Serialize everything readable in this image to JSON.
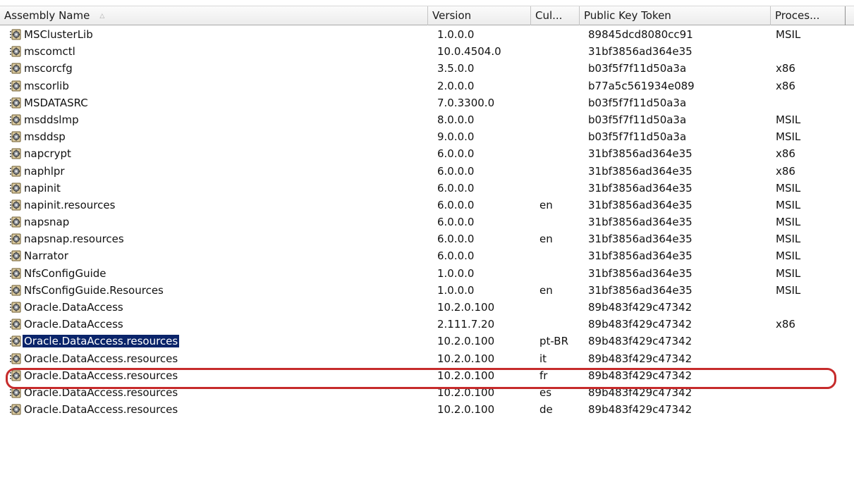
{
  "columns": [
    {
      "key": "name",
      "label": "Assembly Name"
    },
    {
      "key": "version",
      "label": "Version"
    },
    {
      "key": "culture",
      "label": "Cul..."
    },
    {
      "key": "token",
      "label": "Public Key Token"
    },
    {
      "key": "processor",
      "label": "Proces..."
    }
  ],
  "sort": {
    "column": "name",
    "direction": "ascending",
    "icon": "sort-ascending-icon"
  },
  "row_icon": "assembly-icon",
  "selected_row_index": 18,
  "highlight_color": "#c62b2b",
  "selection_color": "#0a246a",
  "rows": [
    {
      "name": "MSClusterLib",
      "version": "1.0.0.0",
      "culture": "",
      "token": "89845dcd8080cc91",
      "processor": "MSIL"
    },
    {
      "name": "mscomctl",
      "version": "10.0.4504.0",
      "culture": "",
      "token": "31bf3856ad364e35",
      "processor": ""
    },
    {
      "name": "mscorcfg",
      "version": "3.5.0.0",
      "culture": "",
      "token": "b03f5f7f11d50a3a",
      "processor": "x86"
    },
    {
      "name": "mscorlib",
      "version": "2.0.0.0",
      "culture": "",
      "token": "b77a5c561934e089",
      "processor": "x86"
    },
    {
      "name": "MSDATASRC",
      "version": "7.0.3300.0",
      "culture": "",
      "token": "b03f5f7f11d50a3a",
      "processor": ""
    },
    {
      "name": "msddslmp",
      "version": "8.0.0.0",
      "culture": "",
      "token": "b03f5f7f11d50a3a",
      "processor": "MSIL"
    },
    {
      "name": "msddsp",
      "version": "9.0.0.0",
      "culture": "",
      "token": "b03f5f7f11d50a3a",
      "processor": "MSIL"
    },
    {
      "name": "napcrypt",
      "version": "6.0.0.0",
      "culture": "",
      "token": "31bf3856ad364e35",
      "processor": "x86"
    },
    {
      "name": "naphlpr",
      "version": "6.0.0.0",
      "culture": "",
      "token": "31bf3856ad364e35",
      "processor": "x86"
    },
    {
      "name": "napinit",
      "version": "6.0.0.0",
      "culture": "",
      "token": "31bf3856ad364e35",
      "processor": "MSIL"
    },
    {
      "name": "napinit.resources",
      "version": "6.0.0.0",
      "culture": "en",
      "token": "31bf3856ad364e35",
      "processor": "MSIL"
    },
    {
      "name": "napsnap",
      "version": "6.0.0.0",
      "culture": "",
      "token": "31bf3856ad364e35",
      "processor": "MSIL"
    },
    {
      "name": "napsnap.resources",
      "version": "6.0.0.0",
      "culture": "en",
      "token": "31bf3856ad364e35",
      "processor": "MSIL"
    },
    {
      "name": "Narrator",
      "version": "6.0.0.0",
      "culture": "",
      "token": "31bf3856ad364e35",
      "processor": "MSIL"
    },
    {
      "name": "NfsConfigGuide",
      "version": "1.0.0.0",
      "culture": "",
      "token": "31bf3856ad364e35",
      "processor": "MSIL"
    },
    {
      "name": "NfsConfigGuide.Resources",
      "version": "1.0.0.0",
      "culture": "en",
      "token": "31bf3856ad364e35",
      "processor": "MSIL"
    },
    {
      "name": "Oracle.DataAccess",
      "version": "10.2.0.100",
      "culture": "",
      "token": "89b483f429c47342",
      "processor": ""
    },
    {
      "name": "Oracle.DataAccess",
      "version": "2.111.7.20",
      "culture": "",
      "token": "89b483f429c47342",
      "processor": "x86"
    },
    {
      "name": "Oracle.DataAccess.resources",
      "version": "10.2.0.100",
      "culture": "pt-BR",
      "token": "89b483f429c47342",
      "processor": ""
    },
    {
      "name": "Oracle.DataAccess.resources",
      "version": "10.2.0.100",
      "culture": "it",
      "token": "89b483f429c47342",
      "processor": ""
    },
    {
      "name": "Oracle.DataAccess.resources",
      "version": "10.2.0.100",
      "culture": "fr",
      "token": "89b483f429c47342",
      "processor": ""
    },
    {
      "name": "Oracle.DataAccess.resources",
      "version": "10.2.0.100",
      "culture": "es",
      "token": "89b483f429c47342",
      "processor": ""
    },
    {
      "name": "Oracle.DataAccess.resources",
      "version": "10.2.0.100",
      "culture": "de",
      "token": "89b483f429c47342",
      "processor": ""
    }
  ]
}
